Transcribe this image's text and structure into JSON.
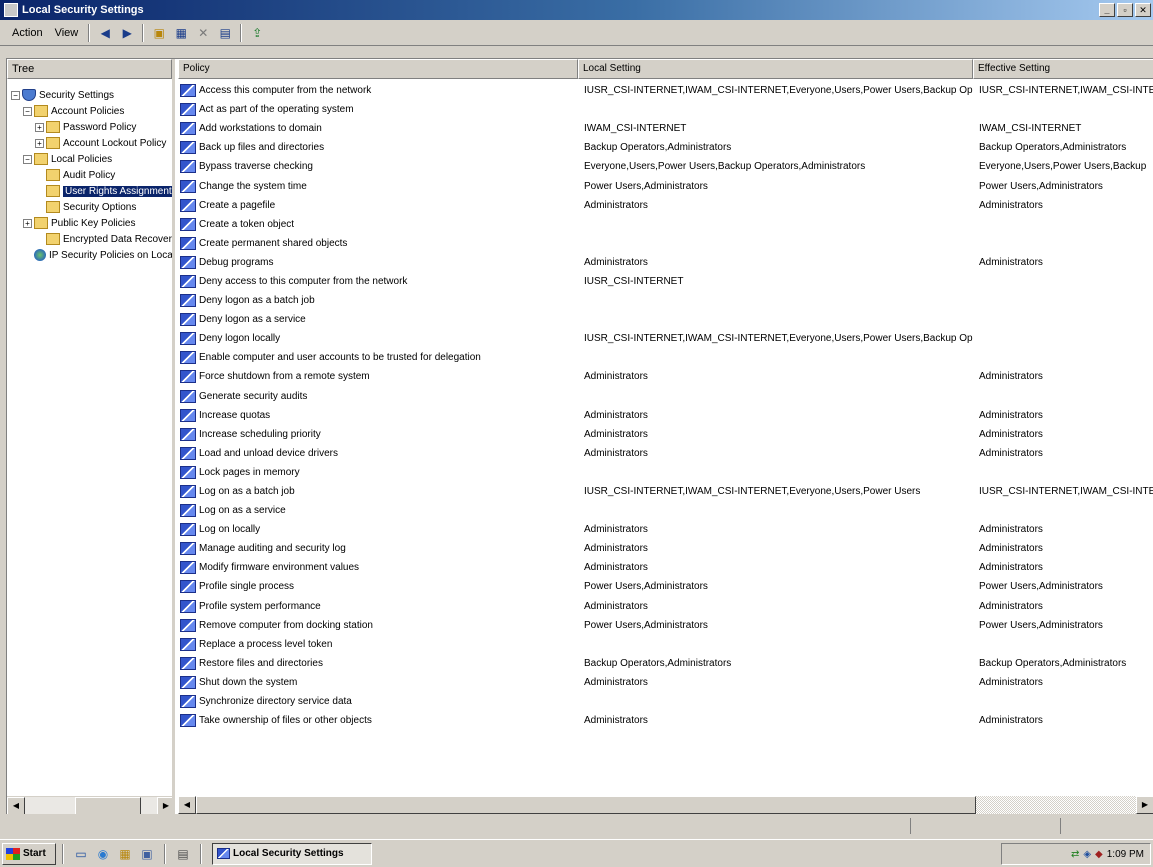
{
  "window": {
    "title": "Local Security Settings",
    "min": "_",
    "max": "▫",
    "close": "✕"
  },
  "menu": {
    "action": "Action",
    "view": "View"
  },
  "tree": {
    "header": "Tree",
    "nodes": [
      {
        "label": "Security Settings",
        "indent": 0,
        "icon": "shield",
        "exp": "−"
      },
      {
        "label": "Account Policies",
        "indent": 1,
        "icon": "yellow",
        "exp": "−"
      },
      {
        "label": "Password Policy",
        "indent": 2,
        "icon": "yellow",
        "exp": "+"
      },
      {
        "label": "Account Lockout Policy",
        "indent": 2,
        "icon": "yellow",
        "exp": "+"
      },
      {
        "label": "Local Policies",
        "indent": 1,
        "icon": "yellow",
        "exp": "−"
      },
      {
        "label": "Audit Policy",
        "indent": 2,
        "icon": "yellow",
        "exp": ""
      },
      {
        "label": "User Rights Assignment",
        "indent": 2,
        "icon": "yellow",
        "exp": "",
        "selected": true
      },
      {
        "label": "Security Options",
        "indent": 2,
        "icon": "yellow",
        "exp": ""
      },
      {
        "label": "Public Key Policies",
        "indent": 1,
        "icon": "yellow",
        "exp": "+"
      },
      {
        "label": "Encrypted Data Recovery Agents",
        "indent": 2,
        "icon": "yellow",
        "exp": ""
      },
      {
        "label": "IP Security Policies on Local Machine",
        "indent": 1,
        "icon": "globe",
        "exp": ""
      }
    ]
  },
  "list": {
    "columns": [
      "Policy",
      "Local Setting",
      "Effective Setting"
    ],
    "rows": [
      [
        "Access this computer from the network",
        "IUSR_CSI-INTERNET,IWAM_CSI-INTERNET,Everyone,Users,Power Users,Backup Operators,Administrators",
        "IUSR_CSI-INTERNET,IWAM_CSI-INTERNET,Everyone"
      ],
      [
        "Act as part of the operating system",
        "",
        ""
      ],
      [
        "Add workstations to domain",
        "IWAM_CSI-INTERNET",
        "IWAM_CSI-INTERNET"
      ],
      [
        "Back up files and directories",
        "Backup Operators,Administrators",
        "Backup Operators,Administrators"
      ],
      [
        "Bypass traverse checking",
        "Everyone,Users,Power Users,Backup Operators,Administrators",
        "Everyone,Users,Power Users,Backup"
      ],
      [
        "Change the system time",
        "Power Users,Administrators",
        "Power Users,Administrators"
      ],
      [
        "Create a pagefile",
        "Administrators",
        "Administrators"
      ],
      [
        "Create a token object",
        "",
        ""
      ],
      [
        "Create permanent shared objects",
        "",
        ""
      ],
      [
        "Debug programs",
        "Administrators",
        "Administrators"
      ],
      [
        "Deny access to this computer from the network",
        "IUSR_CSI-INTERNET",
        ""
      ],
      [
        "Deny logon as a batch job",
        "",
        ""
      ],
      [
        "Deny logon as a service",
        "",
        ""
      ],
      [
        "Deny logon locally",
        "IUSR_CSI-INTERNET,IWAM_CSI-INTERNET,Everyone,Users,Power Users,Backup Operators",
        ""
      ],
      [
        "Enable computer and user accounts to be trusted for delegation",
        "",
        ""
      ],
      [
        "Force shutdown from a remote system",
        "Administrators",
        "Administrators"
      ],
      [
        "Generate security audits",
        "",
        ""
      ],
      [
        "Increase quotas",
        "Administrators",
        "Administrators"
      ],
      [
        "Increase scheduling priority",
        "Administrators",
        "Administrators"
      ],
      [
        "Load and unload device drivers",
        "Administrators",
        "Administrators"
      ],
      [
        "Lock pages in memory",
        "",
        ""
      ],
      [
        "Log on as a batch job",
        "IUSR_CSI-INTERNET,IWAM_CSI-INTERNET,Everyone,Users,Power Users",
        "IUSR_CSI-INTERNET,IWAM_CSI-INTERNET"
      ],
      [
        "Log on as a service",
        "",
        ""
      ],
      [
        "Log on locally",
        "Administrators",
        "Administrators"
      ],
      [
        "Manage auditing and security log",
        "Administrators",
        "Administrators"
      ],
      [
        "Modify firmware environment values",
        "Administrators",
        "Administrators"
      ],
      [
        "Profile single process",
        "Power Users,Administrators",
        "Power Users,Administrators"
      ],
      [
        "Profile system performance",
        "Administrators",
        "Administrators"
      ],
      [
        "Remove computer from docking station",
        "Power Users,Administrators",
        "Power Users,Administrators"
      ],
      [
        "Replace a process level token",
        "",
        ""
      ],
      [
        "Restore files and directories",
        "Backup Operators,Administrators",
        "Backup Operators,Administrators"
      ],
      [
        "Shut down the system",
        "Administrators",
        "Administrators"
      ],
      [
        "Synchronize directory service data",
        "",
        ""
      ],
      [
        "Take ownership of files or other objects",
        "Administrators",
        "Administrators"
      ]
    ]
  },
  "taskbar": {
    "start": "Start",
    "task": "Local Security Settings",
    "clock": "1:09 PM"
  },
  "colors": {
    "title_start": "#0a246a",
    "title_end": "#a6caf0",
    "selection": "#0a246a"
  }
}
